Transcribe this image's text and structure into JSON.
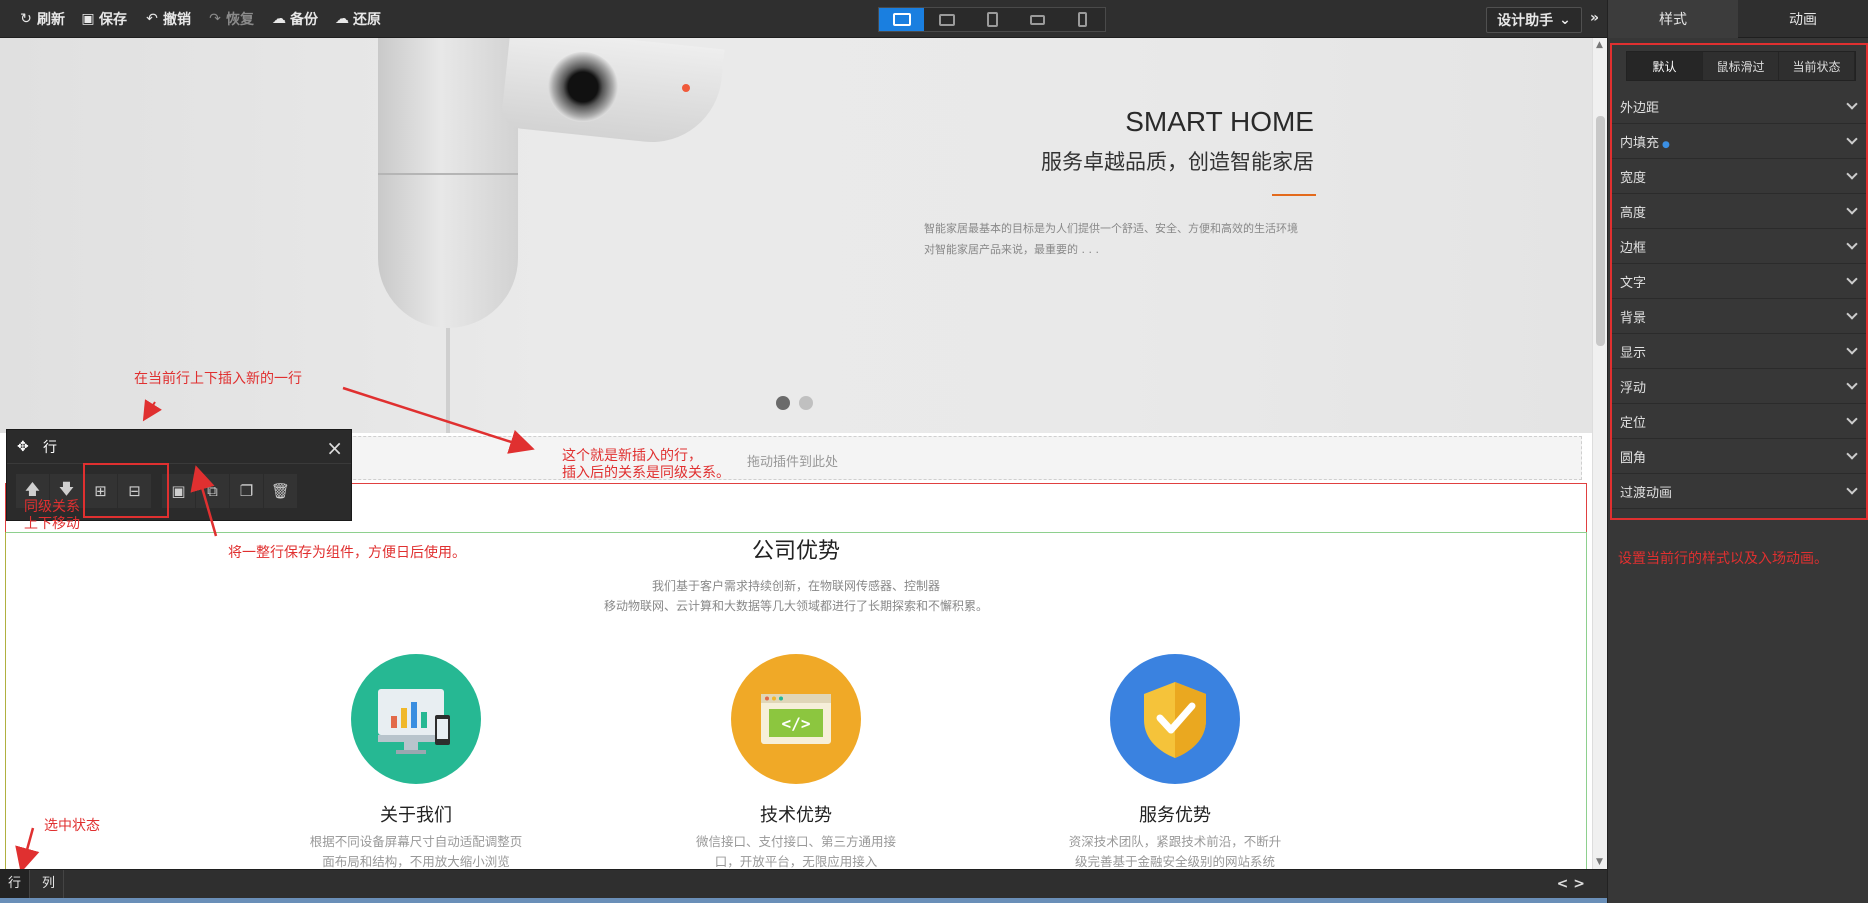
{
  "toolbar": {
    "refresh": "刷新",
    "save": "保存",
    "undo": "撤销",
    "redo": "恢复",
    "backup": "备份",
    "restore": "还原",
    "design_helper": "设计助手",
    "icons": {
      "refresh": "refresh-icon",
      "save": "floppy-icon",
      "undo": "undo-icon",
      "redo": "redo-icon",
      "backup": "cloud-upload-icon",
      "restore": "cloud-download-icon"
    }
  },
  "devices": [
    "desktop",
    "tablet-landscape",
    "tablet-portrait",
    "phone-landscape",
    "phone-portrait"
  ],
  "banner": {
    "title": "SMART HOME",
    "subtitle": "服务卓越品质，创造智能家居",
    "desc_line1": "智能家居最基本的目标是为人们提供一个舒适、安全、方便和高效的生活环境",
    "desc_line2": "对智能家居产品来说，最重要的 . . ."
  },
  "new_row": {
    "placeholder": "拖动插件到此处"
  },
  "section": {
    "title": "公司优势",
    "desc_line1": "我们基于客户需求持续创新，在物联网传感器、控制器",
    "desc_line2": "移动物联网、云计算和大数据等几大领域都进行了长期探索和不懈积累。",
    "features": [
      {
        "title": "关于我们",
        "line1": "根据不同设备屏幕尺寸自动适配调整页",
        "line2": "面布局和结构，不用放大缩小浏览",
        "color": "#26b893"
      },
      {
        "title": "技术优势",
        "line1": "微信接口、支付接口、第三方通用接",
        "line2": "口，开放平台，无限应用接入",
        "color": "#f0a927"
      },
      {
        "title": "服务优势",
        "line1": "资深技术团队，紧跟技术前沿，不断升",
        "line2": "级完善基于金融安全级别的网站系统",
        "color": "#3a82e0"
      }
    ]
  },
  "row_panel": {
    "title": "行",
    "tools": [
      "move-up",
      "move-down",
      "insert-row-above",
      "insert-row-below",
      "save-as-component",
      "copy",
      "paste",
      "delete"
    ]
  },
  "bottom": {
    "tab_row": "行",
    "tab_col": "列",
    "code_toggle": "< >"
  },
  "right_panel": {
    "tab_style": "样式",
    "tab_anim": "动画",
    "states": [
      "默认",
      "鼠标滑过",
      "当前状态"
    ],
    "props": [
      "外边距",
      "内填充",
      "宽度",
      "高度",
      "边框",
      "文字",
      "背景",
      "显示",
      "浮动",
      "定位",
      "圆角",
      "过渡动画"
    ]
  },
  "annotations": {
    "insert_row": "在当前行上下插入新的一行",
    "new_row_1": "这个就是新插入的行，",
    "new_row_2": "插入后的关系是同级关系。",
    "sibling_1": "同级关系",
    "sibling_2": "上下移动",
    "save_component": "将一整行保存为组件，方便日后使用。",
    "selected": "选中状态",
    "style_note": "设置当前行的样式以及入场动画。"
  },
  "colors": {
    "accent": "#1a7fe0",
    "annotation": "#e03030"
  }
}
